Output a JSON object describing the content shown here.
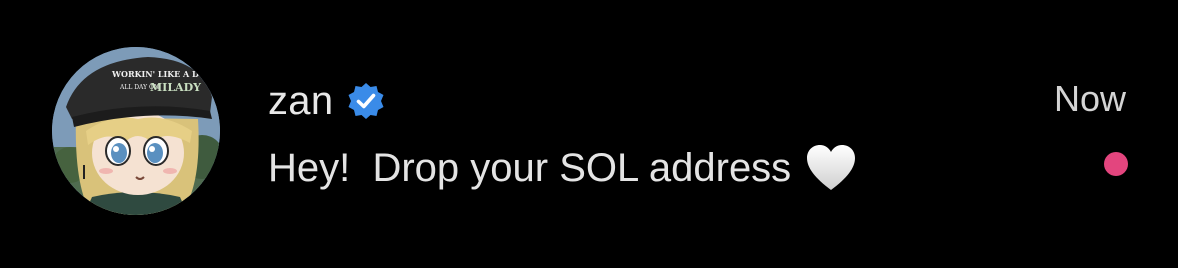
{
  "notification": {
    "sender": {
      "name": "zan",
      "verified": true,
      "avatar": {
        "description_icon": "avatar-milady-cap",
        "cap_text_line1": "WORKIN' LIKE A DOG",
        "cap_text_line2": "ALL DAY ON",
        "cap_text_brand": "MILADY"
      }
    },
    "timestamp": "Now",
    "message": "Hey!  Drop your SOL address",
    "message_emoji": "white-heart-icon",
    "unread": true
  },
  "colors": {
    "background": "#000000",
    "verified_badge": "#3a8be8",
    "unread_dot": "#e3457e",
    "text_primary": "#e6e6e6"
  }
}
